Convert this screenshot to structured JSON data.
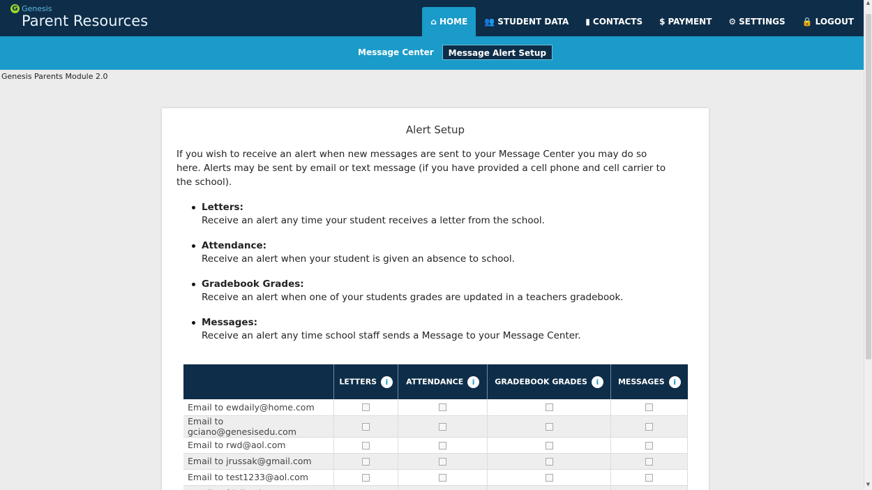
{
  "brand": {
    "company": "Genesis",
    "product": "Parent Resources",
    "logo_letter": "G"
  },
  "nav": {
    "items": [
      {
        "label": "HOME",
        "icon": "home-icon",
        "glyph": "⌂",
        "active": true
      },
      {
        "label": "STUDENT DATA",
        "icon": "users-icon",
        "glyph": "👥",
        "active": false
      },
      {
        "label": "CONTACTS",
        "icon": "contacts-book-icon",
        "glyph": "▮",
        "active": false
      },
      {
        "label": "PAYMENT",
        "icon": "dollar-circle-icon",
        "glyph": "$",
        "active": false
      },
      {
        "label": "SETTINGS",
        "icon": "gear-icon",
        "glyph": "⚙",
        "active": false
      },
      {
        "label": "LOGOUT",
        "icon": "lock-icon",
        "glyph": "🔒",
        "active": false
      }
    ]
  },
  "subnav": {
    "tabs": [
      {
        "label": "Message Center",
        "active": false
      },
      {
        "label": "Message Alert Setup",
        "active": true
      }
    ]
  },
  "version": "Genesis Parents Module 2.0",
  "main": {
    "title": "Alert Setup",
    "intro": "If you wish to receive an alert when new messages are sent to your Message Center you may do so here. Alerts may be sent by email or text message (if you have provided a cell phone and cell carrier to the school).",
    "alerts": [
      {
        "title": "Letters:",
        "desc": "Receive an alert any time your student receives a letter from the school."
      },
      {
        "title": "Attendance:",
        "desc": "Receive an alert when your student is given an absence to school."
      },
      {
        "title": "Gradebook Grades:",
        "desc": "Receive an alert when one of your students grades are updated in a teachers gradebook."
      },
      {
        "title": "Messages:",
        "desc": "Receive an alert any time school staff sends a Message to your Message Center."
      }
    ]
  },
  "table": {
    "columns": [
      "LETTERS",
      "ATTENDANCE",
      "GRADEBOOK GRADES",
      "MESSAGES"
    ],
    "info_glyph": "i",
    "rows": [
      {
        "label": "Email to ewdaily@home.com"
      },
      {
        "label": "Email to gciano@genesisedu.com"
      },
      {
        "label": "Email to rwd@aol.com"
      },
      {
        "label": "Email to jrussak@gmail.com"
      },
      {
        "label": "Email to test1233@aol.com"
      },
      {
        "label": "Email to fdaily@isp.com"
      }
    ]
  },
  "scrollbar": {
    "up": "▲",
    "down": "▼"
  },
  "colors": {
    "topbar": "#0e2d48",
    "accent": "#1a9bc9",
    "table_header": "#0e2d48"
  }
}
